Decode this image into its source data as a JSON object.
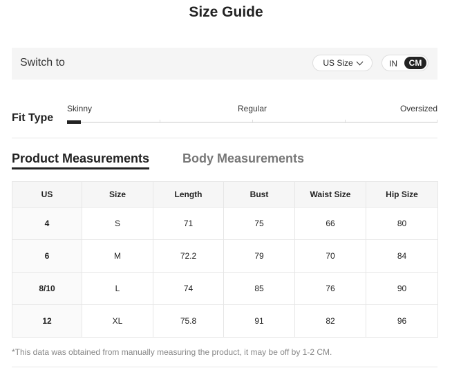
{
  "page": {
    "title": "Size Guide"
  },
  "switch_bar": {
    "label": "Switch to",
    "size_select": {
      "value": "US Size",
      "icon": "chevron-down-icon"
    },
    "unit_toggle": {
      "options": [
        "IN",
        "CM"
      ],
      "selected": "CM"
    }
  },
  "fit": {
    "title": "Fit Type",
    "labels": {
      "skinny": "Skinny",
      "regular": "Regular",
      "oversized": "Oversized"
    },
    "selected": "Skinny"
  },
  "tabs": {
    "product": "Product Measurements",
    "body": "Body Measurements",
    "active": "product"
  },
  "table": {
    "headers": [
      "US",
      "Size",
      "Length",
      "Bust",
      "Waist Size",
      "Hip Size"
    ],
    "rows": [
      [
        "4",
        "S",
        "71",
        "75",
        "66",
        "80"
      ],
      [
        "6",
        "M",
        "72.2",
        "79",
        "70",
        "84"
      ],
      [
        "8/10",
        "L",
        "74",
        "85",
        "76",
        "90"
      ],
      [
        "12",
        "XL",
        "75.8",
        "91",
        "82",
        "96"
      ]
    ]
  },
  "note": "*This data was obtained from manually measuring the product, it may be off by 1-2 CM."
}
